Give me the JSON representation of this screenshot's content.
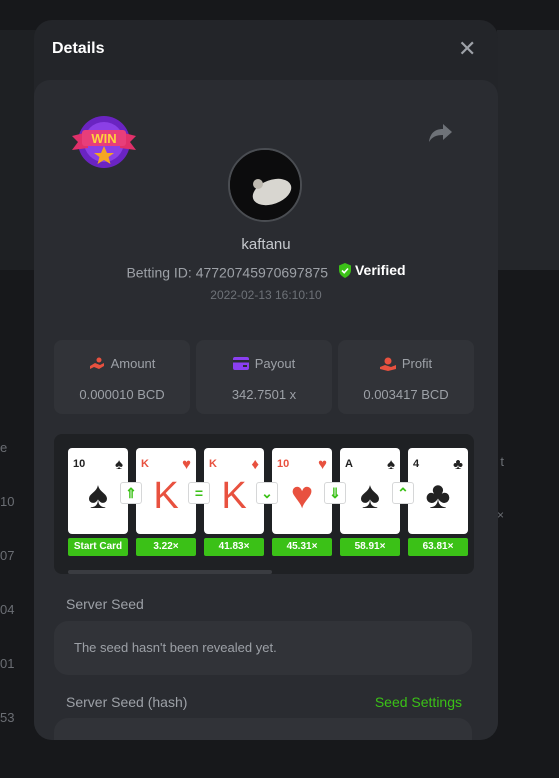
{
  "background": {
    "left_numbers": [
      "e",
      "10",
      "07",
      "04",
      "01",
      "53"
    ],
    "right_label": "t",
    "right_mult": "×"
  },
  "modal": {
    "title": "Details",
    "close_label": "✕"
  },
  "bet": {
    "username": "kaftanu",
    "betting_id_label": "Betting ID:",
    "betting_id": "47720745970697875",
    "verified_label": "Verified",
    "date": "2022-02-13 16:10:10",
    "win_label": "WIN"
  },
  "stats": {
    "amount_label": "Amount",
    "amount_value": "0.000010 BCD",
    "payout_label": "Payout",
    "payout_value": "342.7501 x",
    "profit_label": "Profit",
    "profit_value": "0.003417 BCD"
  },
  "cards": [
    {
      "rank": "10",
      "suit": "♠",
      "color": "#222222",
      "mult": "Start Card",
      "arrow": "⇑"
    },
    {
      "rank": "K",
      "suit": "♥",
      "color": "#e8513f",
      "mult": "3.22×",
      "arrow": "="
    },
    {
      "rank": "K",
      "suit": "♦",
      "color": "#e8513f",
      "mult": "41.83×",
      "arrow": "⌄"
    },
    {
      "rank": "10",
      "suit": "♥",
      "color": "#e8513f",
      "mult": "45.31×",
      "arrow": "⇓"
    },
    {
      "rank": "A",
      "suit": "♠",
      "color": "#222222",
      "mult": "58.91×",
      "arrow": "⌃"
    },
    {
      "rank": "4",
      "suit": "♣",
      "color": "#222222",
      "mult": "63.81×",
      "arrow": ""
    }
  ],
  "seed": {
    "server_seed_label": "Server Seed",
    "server_seed_value": "The seed hasn't been revealed yet.",
    "server_seed_hash_label": "Server Seed (hash)",
    "seed_settings_label": "Seed Settings"
  },
  "colors": {
    "accent_green": "#3bc117",
    "verified_green": "#3bc117",
    "amount_icon": "#e8513f",
    "payout_icon": "#8a3ff0",
    "profit_icon": "#e8513f"
  },
  "icons": {
    "close": "close-icon",
    "share": "share-icon",
    "verified": "shield-check-icon",
    "amount": "coins-icon",
    "payout": "wallet-icon",
    "profit": "hand-coins-icon"
  }
}
